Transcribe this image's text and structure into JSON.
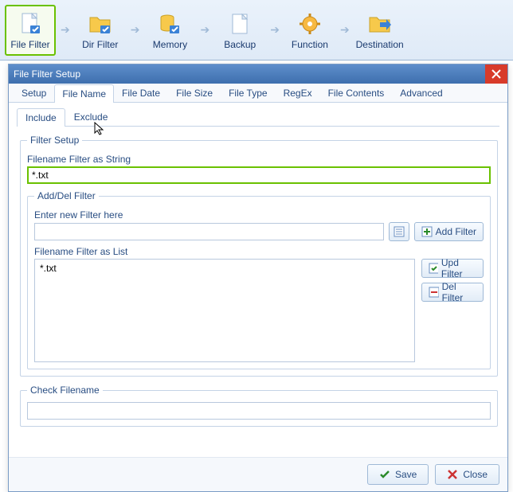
{
  "ribbon": {
    "items": [
      {
        "label": "File Filter"
      },
      {
        "label": "Dir Filter"
      },
      {
        "label": "Memory"
      },
      {
        "label": "Backup"
      },
      {
        "label": "Function"
      },
      {
        "label": "Destination"
      }
    ]
  },
  "dialog": {
    "title": "File Filter Setup",
    "close_icon": "close"
  },
  "tabs1": [
    {
      "label": "Setup"
    },
    {
      "label": "File Name"
    },
    {
      "label": "File Date"
    },
    {
      "label": "File Size"
    },
    {
      "label": "File Type"
    },
    {
      "label": "RegEx"
    },
    {
      "label": "File Contents"
    },
    {
      "label": "Advanced"
    }
  ],
  "tabs2": [
    {
      "label": "Include"
    },
    {
      "label": "Exclude"
    }
  ],
  "filter_setup": {
    "legend": "Filter Setup",
    "string_label": "Filename Filter as String",
    "string_value": "*.txt",
    "adddel_legend": "Add/Del Filter",
    "enter_label": "Enter new Filter here",
    "enter_value": "",
    "add_btn": "Add Filter",
    "list_label": "Filename Filter as List",
    "list_items": [
      "*.txt"
    ],
    "upd_btn": "Upd Filter",
    "del_btn": "Del Filter"
  },
  "check": {
    "legend": "Check Filename",
    "value": ""
  },
  "footer": {
    "save": "Save",
    "close": "Close"
  }
}
